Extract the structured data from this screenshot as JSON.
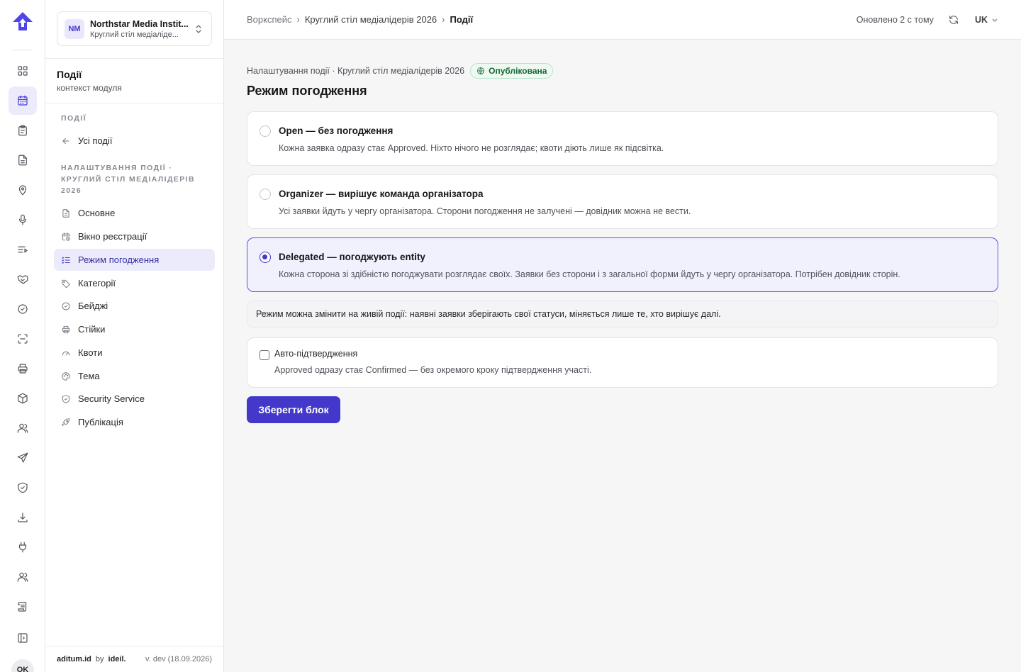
{
  "rail": {
    "avatar": "OK",
    "items": [
      "dashboard-icon",
      "calendar-icon",
      "clipboard-icon",
      "document-icon",
      "map-pin-icon",
      "microphone-icon",
      "list-icon",
      "handshake-icon",
      "check-circle-icon",
      "scan-icon",
      "printer-icon",
      "box-icon",
      "users-icon",
      "send-icon",
      "shield-check-icon",
      "download-icon",
      "plug-icon",
      "users-alt-icon",
      "scroll-icon",
      "panel-icon"
    ],
    "active_index": 1
  },
  "org": {
    "initials": "NM",
    "name": "Northstar Media Instit...",
    "subtitle": "Круглий стіл медіаліде..."
  },
  "module": {
    "title": "Події",
    "subtitle": "контекст модуля"
  },
  "sidebar": {
    "section1": "Події",
    "back_label": "Усі події",
    "section2": "Налаштування події · Круглий стіл медіалідерів 2026",
    "items": [
      {
        "label": "Основне"
      },
      {
        "label": "Вікно реєстрації"
      },
      {
        "label": "Режим погодження"
      },
      {
        "label": "Категорії"
      },
      {
        "label": "Бейджі"
      },
      {
        "label": "Стійки"
      },
      {
        "label": "Квоти"
      },
      {
        "label": "Тема"
      },
      {
        "label": "Security Service"
      },
      {
        "label": "Публікація"
      }
    ],
    "active_index": 2
  },
  "footer": {
    "brand": "aditum.id",
    "by": "by",
    "maker": "ideil.",
    "version": "v. dev (18.09.2026)"
  },
  "topbar": {
    "breadcrumb": [
      "Воркспейс",
      "Круглий стіл медіалідерів 2026",
      "Події"
    ],
    "separator": "›",
    "updated": "Оновлено 2 с тому",
    "lang": "UK"
  },
  "page": {
    "eyebrow": "Налаштування події · Круглий стіл медіалідерів 2026",
    "status": "Опублікована",
    "title": "Режим погодження",
    "options": [
      {
        "title": "Open — без погодження",
        "desc": "Кожна заявка одразу стає Approved. Ніхто нічого не розглядає; квоти діють лише як підсвітка.",
        "selected": false
      },
      {
        "title": "Organizer — вирішує команда організатора",
        "desc": "Усі заявки йдуть у чергу організатора. Сторони погодження не залучені — довідник можна не вести.",
        "selected": false
      },
      {
        "title": "Delegated — погоджують entity",
        "desc": "Кожна сторона зі здібністю погоджувати розглядає своїх. Заявки без сторони і з загальної форми йдуть у чергу організатора. Потрібен довідник сторін.",
        "selected": true
      }
    ],
    "note": "Режим можна змінити на живій події: наявні заявки зберігають свої статуси, міняється лише те, хто вирішує далі.",
    "auto": {
      "label": "Авто-підтвердження",
      "desc": "Approved одразу стає Confirmed — без окремого кроку підтвердження участі.",
      "checked": false
    },
    "save_label": "Зберегти блок"
  },
  "colors": {
    "accent": "#4338ca",
    "status_green": "#166534"
  }
}
